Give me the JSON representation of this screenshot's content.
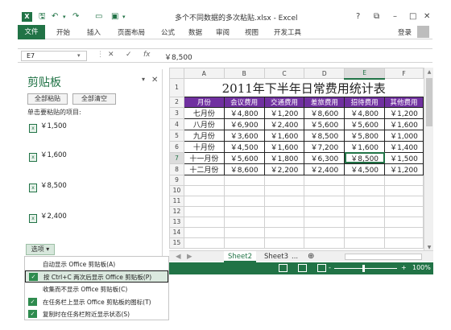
{
  "window": {
    "title": "多个不同数据的多次粘贴.xlsx - Excel",
    "logo": "X",
    "help": "?",
    "restore": "⧉",
    "minimize": "–",
    "maximize": "□",
    "close": "✕"
  },
  "ribbon": {
    "tabs": [
      "文件",
      "开始",
      "插入",
      "页面布局",
      "公式",
      "数据",
      "审阅",
      "视图",
      "开发工具"
    ],
    "signin": "登录"
  },
  "formula_bar": {
    "name_box": "E7",
    "cancel": "✕",
    "enter": "✓",
    "fx": "fx",
    "value": "￥8,500"
  },
  "clipboard": {
    "title": "剪贴板",
    "paste_all": "全部粘贴",
    "clear_all": "全部清空",
    "hint": "单击要粘贴的项目:",
    "items": [
      "￥1,500",
      "￥1,600",
      "￥8,500",
      "￥2,400"
    ],
    "options": "选项 ▾"
  },
  "options_menu": [
    {
      "label": "自动显示 Office 剪贴板(A)",
      "checked": false,
      "highlight": false
    },
    {
      "label": "按 Ctrl+C 两次后显示 Office 剪贴板(P)",
      "checked": true,
      "highlight": true
    },
    {
      "label": "收集而不显示 Office 剪贴板(C)",
      "checked": false,
      "highlight": false
    },
    {
      "label": "在任务栏上显示 Office 剪贴板的图标(T)",
      "checked": true,
      "highlight": false
    },
    {
      "label": "复制时在任务栏附近显示状态(S)",
      "checked": true,
      "highlight": false
    }
  ],
  "sheet": {
    "columns": [
      "A",
      "B",
      "C",
      "D",
      "E",
      "F"
    ],
    "rows": [
      "1",
      "2",
      "3",
      "4",
      "5",
      "6",
      "7",
      "8",
      "9",
      "10",
      "11",
      "12",
      "13",
      "14",
      "15"
    ],
    "title": "2011年下半年日常费用统计表",
    "headers": [
      "月份",
      "会议费用",
      "交通费用",
      "差旅费用",
      "招待费用",
      "其他费用"
    ],
    "data": [
      [
        "七月份",
        "￥4,800",
        "￥1,200",
        "￥8,600",
        "￥4,800",
        "￥1,200"
      ],
      [
        "八月份",
        "￥6,900",
        "￥2,400",
        "￥5,600",
        "￥5,600",
        "￥1,600"
      ],
      [
        "九月份",
        "￥3,600",
        "￥1,600",
        "￥8,500",
        "￥5,800",
        "￥1,000"
      ],
      [
        "十月份",
        "￥4,500",
        "￥1,600",
        "￥7,200",
        "￥1,600",
        "￥1,400"
      ],
      [
        "十一月份",
        "￥5,600",
        "￥1,800",
        "￥6,300",
        "￥8,500",
        "￥1,500"
      ],
      [
        "十二月份",
        "￥8,600",
        "￥2,200",
        "￥2,400",
        "￥4,500",
        "￥1,200"
      ]
    ]
  },
  "sheet_tabs": {
    "prev": "◀",
    "next": "▶",
    "tabs": [
      "Sheet2",
      "Sheet3"
    ],
    "more": "...",
    "add": "⊕"
  },
  "statusbar": {
    "zoom_minus": "-",
    "zoom_plus": "+",
    "zoom": "100%"
  },
  "colors": {
    "accent": "#217346",
    "header_fill": "#7030a0"
  }
}
